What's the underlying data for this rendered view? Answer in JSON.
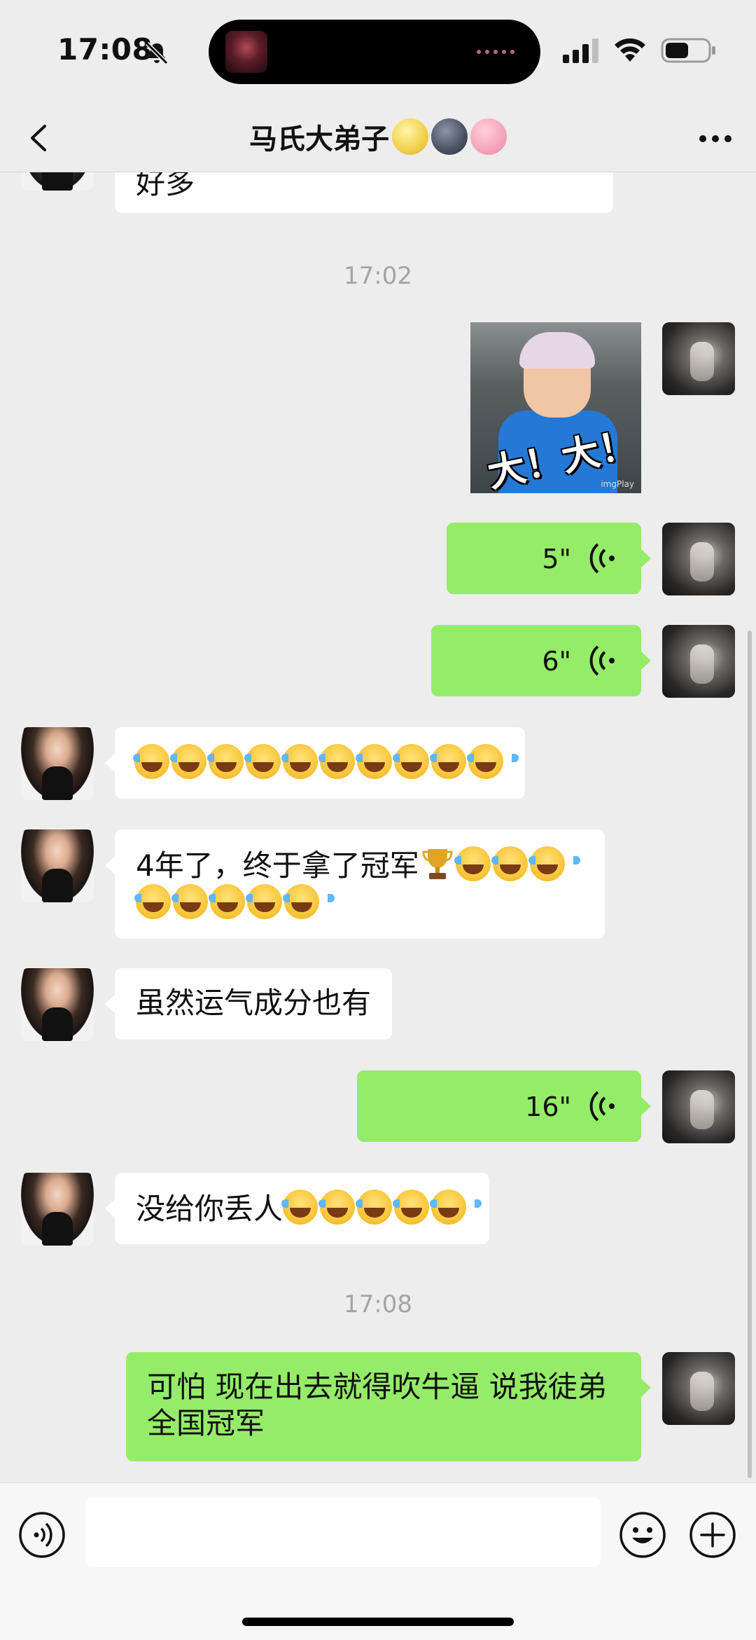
{
  "status_bar": {
    "time": "17:08",
    "silent_icon": "bell-slash-icon",
    "signal_icon": "cellular-signal-icon",
    "wifi_icon": "wifi-icon",
    "battery_icon": "battery-icon",
    "battery_level": 0.55
  },
  "header": {
    "title": "马氏大弟子",
    "title_emojis": [
      "full-moon-face-emoji",
      "new-moon-face-emoji",
      "pig-face-emoji"
    ],
    "back_icon": "chevron-left-icon",
    "more_icon": "ellipsis-icon"
  },
  "chat": {
    "partial_message": "好多",
    "timestamp_1": "17:02",
    "sticker": {
      "caption": "大！大！",
      "watermark": "imgPlay"
    },
    "voice_1": "5\"",
    "voice_2": "6\"",
    "msg_laugh_row": "😂😂😂😂😂😂😂😂😂😂",
    "msg_champion": {
      "text": "4年了，终于拿了冠军",
      "emoji_trophy": "trophy-emoji",
      "emoji_tail": "😂😂😂😂😂😂😂😂"
    },
    "msg_luck": "虽然运气成分也有",
    "voice_3": "16\"",
    "msg_shame": {
      "text": "没给你丢人",
      "emoji_tail": "😂😂😂😂😂"
    },
    "timestamp_2": "17:08",
    "msg_brag": {
      "line1": "可怕 现在出去就得吹牛逼 说我徒弟",
      "line2": "全国冠军"
    }
  },
  "input_bar": {
    "voice_icon": "voice-mode-icon",
    "input_value": "",
    "emoji_icon": "smiley-icon",
    "plus_icon": "plus-circle-icon"
  },
  "colors": {
    "background": "#ededed",
    "bubble_sent": "#95ec69",
    "bubble_received": "#ffffff",
    "timestamp": "#a4a4a4"
  }
}
